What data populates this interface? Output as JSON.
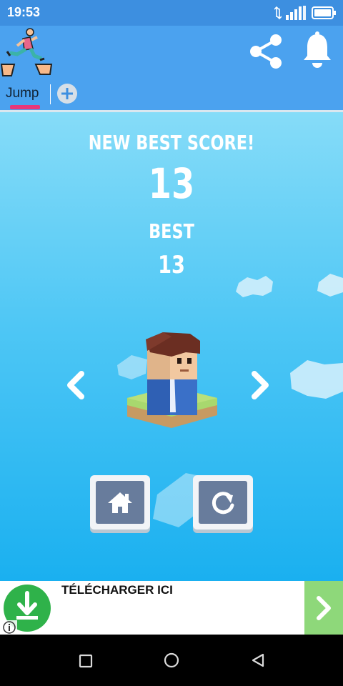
{
  "status_bar": {
    "time": "19:53"
  },
  "tabs": [
    {
      "label": "Jump"
    }
  ],
  "game": {
    "headline": "NEW BEST SCORE!",
    "score": "13",
    "best_label": "BEST",
    "best_score": "13"
  },
  "ad": {
    "text": "TÉLÉCHARGER ICI"
  },
  "colors": {
    "header": "#4ba2ef",
    "status_bar": "#3d8fe0",
    "tab_indicator": "#e8377a",
    "ad_green": "#2fb24a"
  }
}
